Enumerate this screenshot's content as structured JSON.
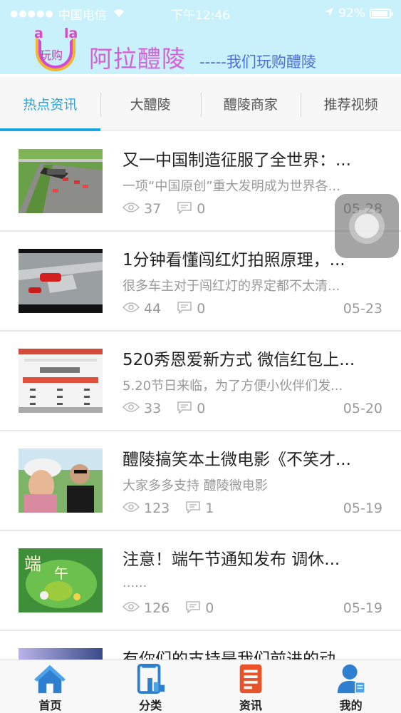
{
  "status_bar": {
    "carrier": "中国电信",
    "time": "下午12:46",
    "battery": "92%",
    "battery_level": 0.92
  },
  "header": {
    "logo": {
      "letter_a": "a",
      "letter_la": "la",
      "badge": "玩购"
    },
    "brand_name": "阿拉醴陵",
    "slogan": "-----我们玩购醴陵"
  },
  "tabs": [
    {
      "label": "热点资讯",
      "active": true
    },
    {
      "label": "大醴陵",
      "active": false
    },
    {
      "label": "醴陵商家",
      "active": false
    },
    {
      "label": "推荐视频",
      "active": false
    }
  ],
  "news": [
    {
      "title": "又一中国制造征服了全世界：...",
      "summary": "一项“中国原创”重大发明成为世界各...",
      "views": "37",
      "comments": "0",
      "date": "05-28",
      "thumb": "bus-road"
    },
    {
      "title": "1分钟看懂闯红灯拍照原理，...",
      "summary": "很多车主对于闯红灯的界定都不太清...",
      "views": "44",
      "comments": "0",
      "date": "05-23",
      "thumb": "red-car-crossing"
    },
    {
      "title": "520秀恩爱新方式 微信红包上...",
      "summary": "5.20节日来临，为了方便小伙伴们发...",
      "views": "33",
      "comments": "0",
      "date": "05-20",
      "thumb": "wechat-keypad"
    },
    {
      "title": "醴陵搞笑本土微电影《不笑才...",
      "summary": "大家多多支持 醴陵微电影",
      "views": "123",
      "comments": "1",
      "date": "05-19",
      "thumb": "two-people"
    },
    {
      "title": "注意！端午节通知发布 调休...",
      "summary": "......",
      "views": "126",
      "comments": "0",
      "date": "05-19",
      "thumb": "dragon-boat"
    },
    {
      "title": "有你们的支持是我们前进的动...",
      "summary": "",
      "views": "",
      "comments": "",
      "date": "",
      "thumb": "partial"
    }
  ],
  "bottom_nav": [
    {
      "label": "首页",
      "icon": "home-icon",
      "color": "#2f7fd0"
    },
    {
      "label": "分类",
      "icon": "category-icon",
      "color": "#2f7fd0"
    },
    {
      "label": "资讯",
      "icon": "news-icon",
      "color": "#e8532a"
    },
    {
      "label": "我的",
      "icon": "profile-icon",
      "color": "#2f7fd0"
    }
  ],
  "colors": {
    "header_bg": "#c9f1fb",
    "accent": "#2aa6d8",
    "brand": "#d760d8",
    "slogan": "#4d6fd6"
  }
}
